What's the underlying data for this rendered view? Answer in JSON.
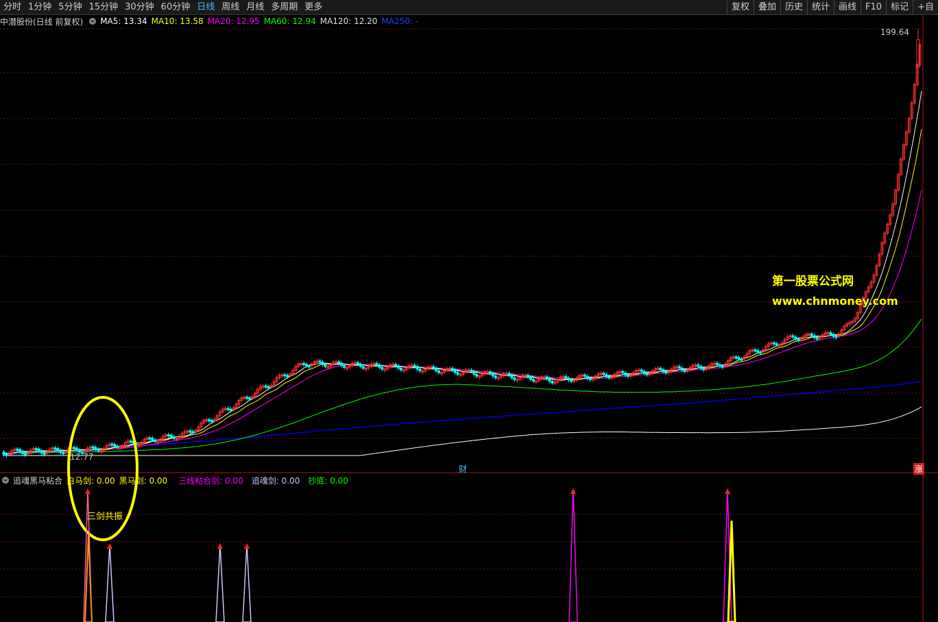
{
  "toolbar": {
    "periods": [
      "分时",
      "1分钟",
      "5分钟",
      "15分钟",
      "30分钟",
      "60分钟",
      "日线",
      "周线",
      "月线",
      "多周期",
      "更多"
    ],
    "active_period": "日线",
    "right_buttons": [
      "复权",
      "叠加",
      "历史",
      "统计",
      "画线",
      "F10",
      "标记",
      "+自"
    ]
  },
  "info": {
    "stock": "中潜股份(日线 前复权)",
    "ma5_label": "MA5: 13.34",
    "ma10_label": "MA10: 13.58",
    "ma20_label": "MA20: 12.95",
    "ma60_label": "MA60: 12.94",
    "ma120_label": "MA120: 12.20",
    "ma250_label": "MA250: -"
  },
  "price_labels": {
    "high": "199.64",
    "low": "12.77",
    "cai": "财",
    "zhang": "涨"
  },
  "indicator": {
    "name": "追魂黑马粘合",
    "baima": "白马剑: 0.00",
    "heima": "黑马剑: 0.00",
    "sanxian": "三线粘合剑: 0.00",
    "zhuihun": "追魂剑: 0.00",
    "chaodi": "抄底: 0.00",
    "annotation": "三剑共振"
  },
  "watermark": {
    "line1": "第一股票公式网",
    "line2": "www.chnmoney.com"
  },
  "colors": {
    "ma5": "#ffffff",
    "ma10": "#ffff00",
    "ma20": "#ff00ff",
    "ma60": "#00ff00",
    "ma120": "#ffffff",
    "ma250": "#0000ff",
    "up": "#ff3232",
    "down": "#00ffff"
  },
  "chart_data": {
    "type": "candlestick",
    "price_range": [
      12.77,
      199.64
    ],
    "indicator_spikes": [
      {
        "series": "三剑共振",
        "position": "early"
      },
      {
        "series": "追魂剑",
        "position": "early"
      },
      {
        "series": "追魂剑",
        "position": "mid"
      },
      {
        "series": "追魂剑",
        "position": "mid"
      },
      {
        "series": "三线粘合剑",
        "position": "late"
      },
      {
        "series": "三线粘合剑",
        "position": "late"
      }
    ]
  }
}
